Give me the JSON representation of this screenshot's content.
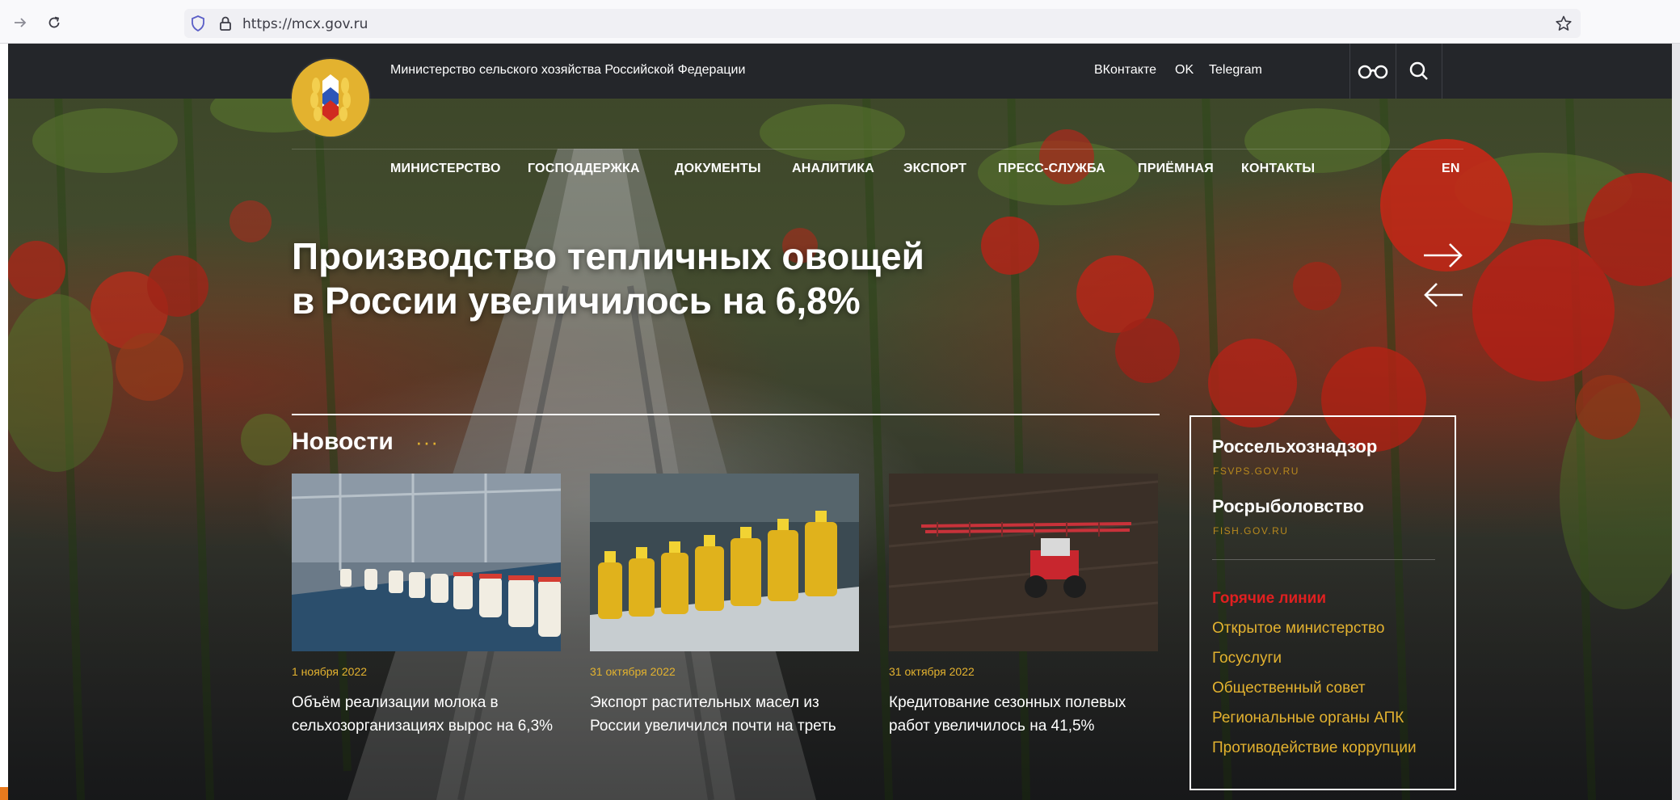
{
  "browser": {
    "url": "https://mcx.gov.ru"
  },
  "header": {
    "ministry_name": "Министерство сельского хозяйства Российской Федерации",
    "social": [
      "ВКонтакте",
      "OK",
      "Telegram"
    ],
    "lang": "EN"
  },
  "nav": {
    "items": [
      "МИНИСТЕРСТВО",
      "ГОСПОДДЕРЖКА",
      "ДОКУМЕНТЫ",
      "АНАЛИТИКА",
      "ЭКСПОРТ",
      "ПРЕСС-СЛУЖБА",
      "ПРИЁМНАЯ",
      "КОНТАКТЫ"
    ]
  },
  "hero": {
    "line1": "Производство тепличных овощей",
    "line2": "в России увеличилось на 6,8%"
  },
  "news": {
    "title": "Новости",
    "more": "···",
    "cards": [
      {
        "date": "1 ноября 2022",
        "title": "Объём реализации молока в сельхозорганизациях вырос на 6,3%"
      },
      {
        "date": "31 октября 2022",
        "title": "Экспорт растительных масел из России увеличился почти на треть"
      },
      {
        "date": "31 октября 2022",
        "title": "Кредитование сезонных полевых работ увеличилось на 41,5%"
      }
    ]
  },
  "sidebar": {
    "agencies": [
      {
        "name": "Россельхознадзор",
        "url": "FSVPS.GOV.RU"
      },
      {
        "name": "Росрыболовство",
        "url": "FISH.GOV.RU"
      }
    ],
    "hotlines": "Горячие линии",
    "links": [
      "Открытое министерство",
      "Госуслуги",
      "Общественный совет",
      "Региональные органы АПК",
      "Противодействие коррупции"
    ]
  },
  "colors": {
    "accent": "#e3b22f",
    "topbar": "#24262a",
    "hotline": "#e02020"
  }
}
